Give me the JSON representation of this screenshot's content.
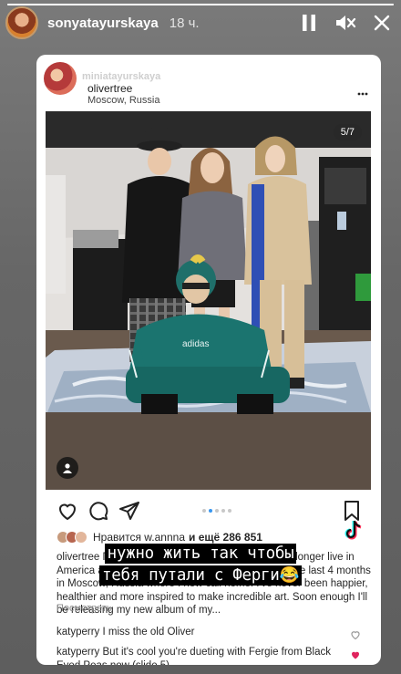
{
  "story": {
    "username": "sonyatayurskaya",
    "time": "18 ч.",
    "progress": 1.0,
    "icons": [
      "pause-icon",
      "mute-icon",
      "close-icon"
    ]
  },
  "post": {
    "reposter": "miniatayurskaya",
    "author": "olivertree",
    "location": "Moscow, Russia",
    "slide_counter": "5/7",
    "likes_prefix": "Нравится",
    "likes_user": "w.annna",
    "likes_conj": "и ещё",
    "likes_count": "286 851",
    "caption_user": "olivertree",
    "caption_text": "Привет, a lot has changed in my life. I no longer live in America and no longer have a bowl cut. I've spent the last 4 months in Moscow, Russia where I now call home. I've never been happier, healthier and more inspired to make incredible art. Soon enough I'll be releasing my new album of my...",
    "more_label": "Посмотреть",
    "comments": [
      {
        "user": "katyperry",
        "text": "I miss the old Oliver"
      },
      {
        "user": "katyperry",
        "text": "But it's cool you're dueting with Fergie from Black Eyed Peas now (slide 5)"
      }
    ]
  },
  "overlay": {
    "line1": "нужно жить так чтобы",
    "line2": "тебя путали с Ферги😂"
  },
  "colors": {
    "accent": "#3897f0",
    "heart_liked": "#e0245e"
  }
}
